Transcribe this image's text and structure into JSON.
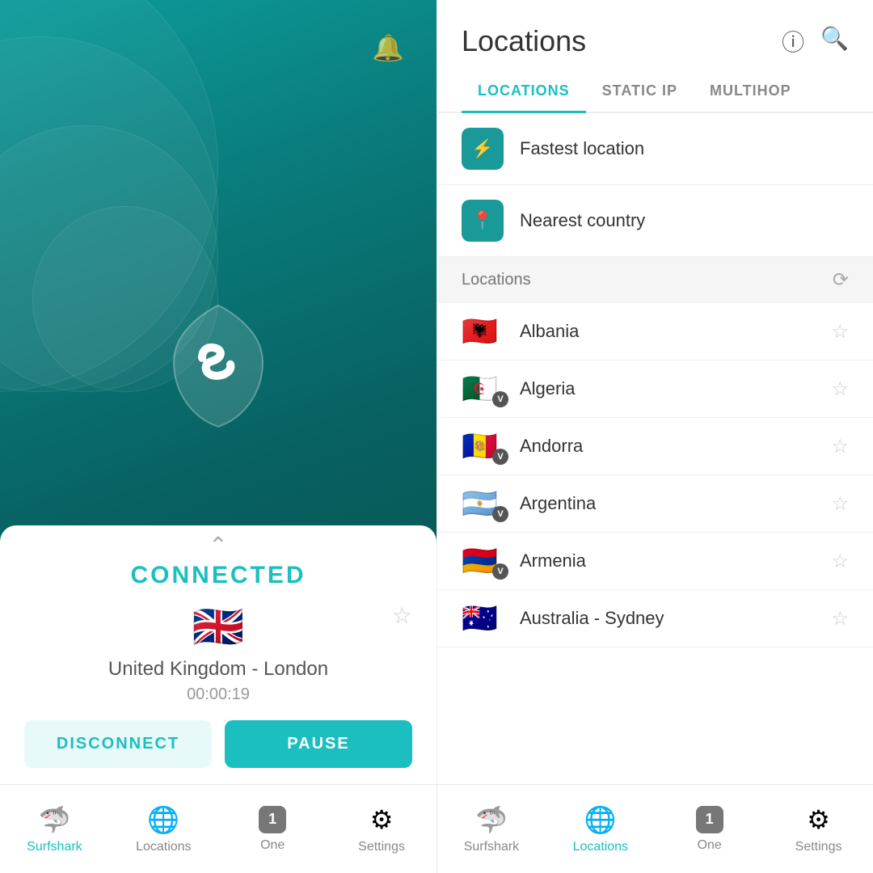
{
  "left": {
    "bell_icon": "🔔",
    "connected_label": "CONNECTED",
    "flag_emoji": "🇬🇧",
    "location_name": "United Kingdom - London",
    "timer": "00:00:19",
    "fav_star": "☆",
    "btn_disconnect": "DISCONNECT",
    "btn_pause": "PAUSE"
  },
  "right": {
    "title": "Locations",
    "info_icon": "ℹ",
    "search_icon": "🔍",
    "tabs": [
      {
        "label": "LOCATIONS",
        "active": true
      },
      {
        "label": "STATIC IP",
        "active": false
      },
      {
        "label": "MULTIHOP",
        "active": false
      }
    ],
    "special_items": [
      {
        "icon": "⚡",
        "label": "Fastest location"
      },
      {
        "icon": "📍",
        "label": "Nearest country"
      }
    ],
    "section": {
      "label": "Locations",
      "icon": "↻"
    },
    "countries": [
      {
        "flag": "🇦🇱",
        "name": "Albania",
        "has_badge": false
      },
      {
        "flag": "🇩🇿",
        "name": "Algeria",
        "has_badge": true
      },
      {
        "flag": "🇦🇩",
        "name": "Andorra",
        "has_badge": true
      },
      {
        "flag": "🇦🇷",
        "name": "Argentina",
        "has_badge": true
      },
      {
        "flag": "🇦🇲",
        "name": "Armenia",
        "has_badge": true
      },
      {
        "flag": "🇦🇺",
        "name": "Australia - Sydney",
        "has_badge": false
      }
    ]
  },
  "bottom_nav_left": [
    {
      "icon": "🦈",
      "label": "Surfshark",
      "active": true
    },
    {
      "icon": "🌐",
      "label": "Locations",
      "active": false
    },
    {
      "icon": "1",
      "label": "One",
      "active": false,
      "is_badge": true
    },
    {
      "icon": "⚙",
      "label": "Settings",
      "active": false
    }
  ],
  "bottom_nav_right": [
    {
      "icon": "🦈",
      "label": "Surfshark",
      "active": false
    },
    {
      "icon": "🌐",
      "label": "Locations",
      "active": true
    },
    {
      "icon": "1",
      "label": "One",
      "active": false,
      "is_badge": true
    },
    {
      "icon": "⚙",
      "label": "Settings",
      "active": false
    }
  ]
}
